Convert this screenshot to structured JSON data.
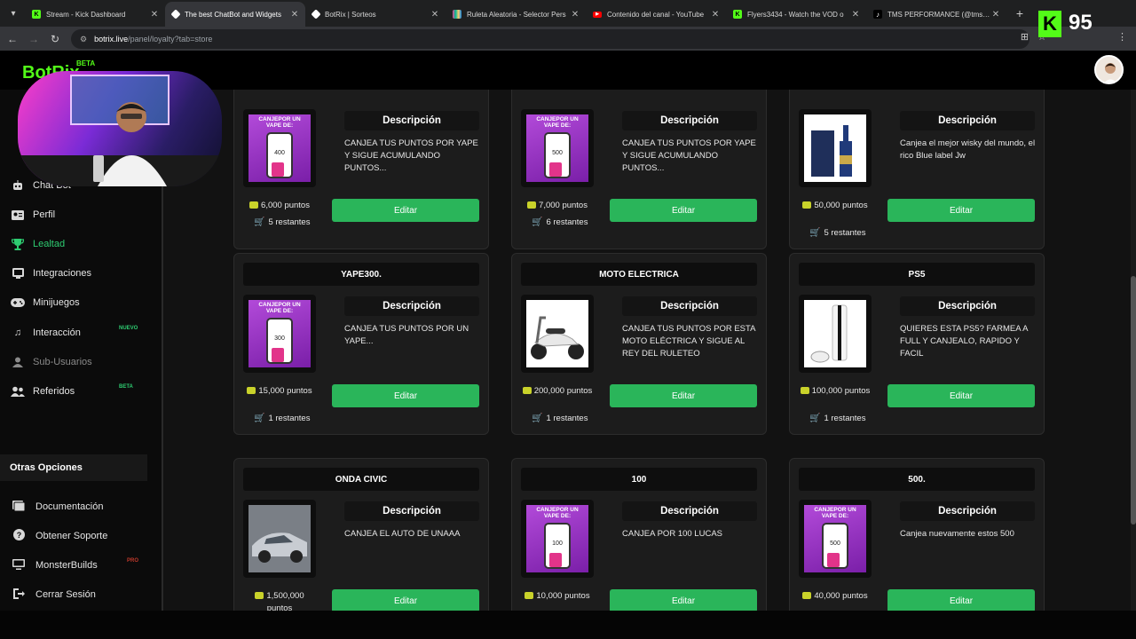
{
  "browser": {
    "tabs": [
      {
        "title": "Stream - Kick Dashboard",
        "favicon": "kick-icon",
        "color": "#53fc18"
      },
      {
        "title": "The best ChatBot and Widgets",
        "favicon": "botrix-icon",
        "color": "#ffffff"
      },
      {
        "title": "BotRix | Sorteos",
        "favicon": "botrix-icon",
        "color": "#ffffff"
      },
      {
        "title": "Ruleta Aleatoria - Selector Pers",
        "favicon": "wheel-icon",
        "color": "#e84393"
      },
      {
        "title": "Contenido del canal - YouTube",
        "favicon": "youtube-icon",
        "color": "#ff0000"
      },
      {
        "title": "Flyers3434 - Watch the VOD o",
        "favicon": "kick-icon",
        "color": "#53fc18"
      },
      {
        "title": "TMS PERFORMANCE (@tmspe",
        "favicon": "tiktok-icon",
        "color": "#ffffff"
      }
    ],
    "url_host": "botrix.live",
    "url_path": "/panel/loyalty?tab=store"
  },
  "overlay": {
    "kick_letter": "K",
    "kick_count": "95"
  },
  "app": {
    "logo": "BotRix",
    "beta": "BETA"
  },
  "sidebar": {
    "items": [
      {
        "label": "Chat Bot",
        "icon": "robot-icon"
      },
      {
        "label": "Perfil",
        "icon": "id-card-icon"
      },
      {
        "label": "Lealtad",
        "icon": "trophy-icon"
      },
      {
        "label": "Integraciones",
        "icon": "integrations-icon"
      },
      {
        "label": "Minijuegos",
        "icon": "gamepad-icon"
      },
      {
        "label": "Interacción",
        "icon": "music-icon",
        "badge": "NUEVO"
      },
      {
        "label": "Sub-Usuarios",
        "icon": "sub-users-icon"
      },
      {
        "label": "Referidos",
        "icon": "users-icon",
        "badge": "BETA"
      }
    ],
    "other_header": "Otras Opciones",
    "other_items": [
      {
        "label": "Documentación",
        "icon": "book-icon"
      },
      {
        "label": "Obtener Soporte",
        "icon": "help-icon"
      },
      {
        "label": "MonsterBuilds",
        "icon": "monitor-icon",
        "badge": "PRO"
      },
      {
        "label": "Cerrar Sesión",
        "icon": "logout-icon"
      }
    ]
  },
  "store": {
    "desc_label": "Descripción",
    "edit_label": "Editar",
    "items": [
      {
        "title": "",
        "desc": "CANJEA TUS PUNTOS POR YAPE Y SIGUE ACUMULANDO PUNTOS...",
        "points": "6,000 puntos",
        "remaining": "5 restantes",
        "image": "vape-400",
        "vape_num": "400"
      },
      {
        "title": "",
        "desc": "CANJEA TUS PUNTOS POR YAPE Y SIGUE ACUMULANDO PUNTOS...",
        "points": "7,000 puntos",
        "remaining": "6 restantes",
        "image": "vape-500",
        "vape_num": "500"
      },
      {
        "title": "",
        "desc": "Canjea el mejor wisky del mundo, el rico Blue label Jw",
        "points": "50,000 puntos",
        "remaining": "5 restantes",
        "image": "whisky"
      },
      {
        "title": "YAPE300.",
        "desc": "CANJEA TUS PUNTOS POR UN YAPE...",
        "points": "15,000 puntos",
        "remaining": "1 restantes",
        "image": "vape-300",
        "vape_num": "300"
      },
      {
        "title": "MOTO ELECTRICA",
        "desc": "CANJEA TUS PUNTOS POR ESTA MOTO ELÉCTRICA Y SIGUE AL REY DEL RULETEO",
        "points": "200,000 puntos",
        "remaining": "1 restantes",
        "image": "scooter"
      },
      {
        "title": "PS5",
        "desc": "QUIERES ESTA PS5? FARMEA A FULL Y CANJEALO, RAPIDO Y FACIL",
        "points": "100,000 puntos",
        "remaining": "1 restantes",
        "image": "ps5"
      },
      {
        "title": "ONDA CIVIC",
        "desc": "CANJEA EL AUTO DE UNAAA",
        "points": "1,500,000 puntos",
        "remaining": "",
        "image": "car"
      },
      {
        "title": "100",
        "desc": "CANJEA POR 100 LUCAS",
        "points": "10,000 puntos",
        "remaining": "",
        "image": "vape-100",
        "vape_num": "100"
      },
      {
        "title": "500.",
        "desc": "Canjea nuevamente estos 500",
        "points": "40,000 puntos",
        "remaining": "",
        "image": "vape-500b",
        "vape_num": "500"
      }
    ],
    "vape_header": "CANJEPOR UN VAPE DE:"
  },
  "colors": {
    "accent": "#2ab55a",
    "kick_green": "#53fc18",
    "active_nav": "#2ecc71"
  }
}
